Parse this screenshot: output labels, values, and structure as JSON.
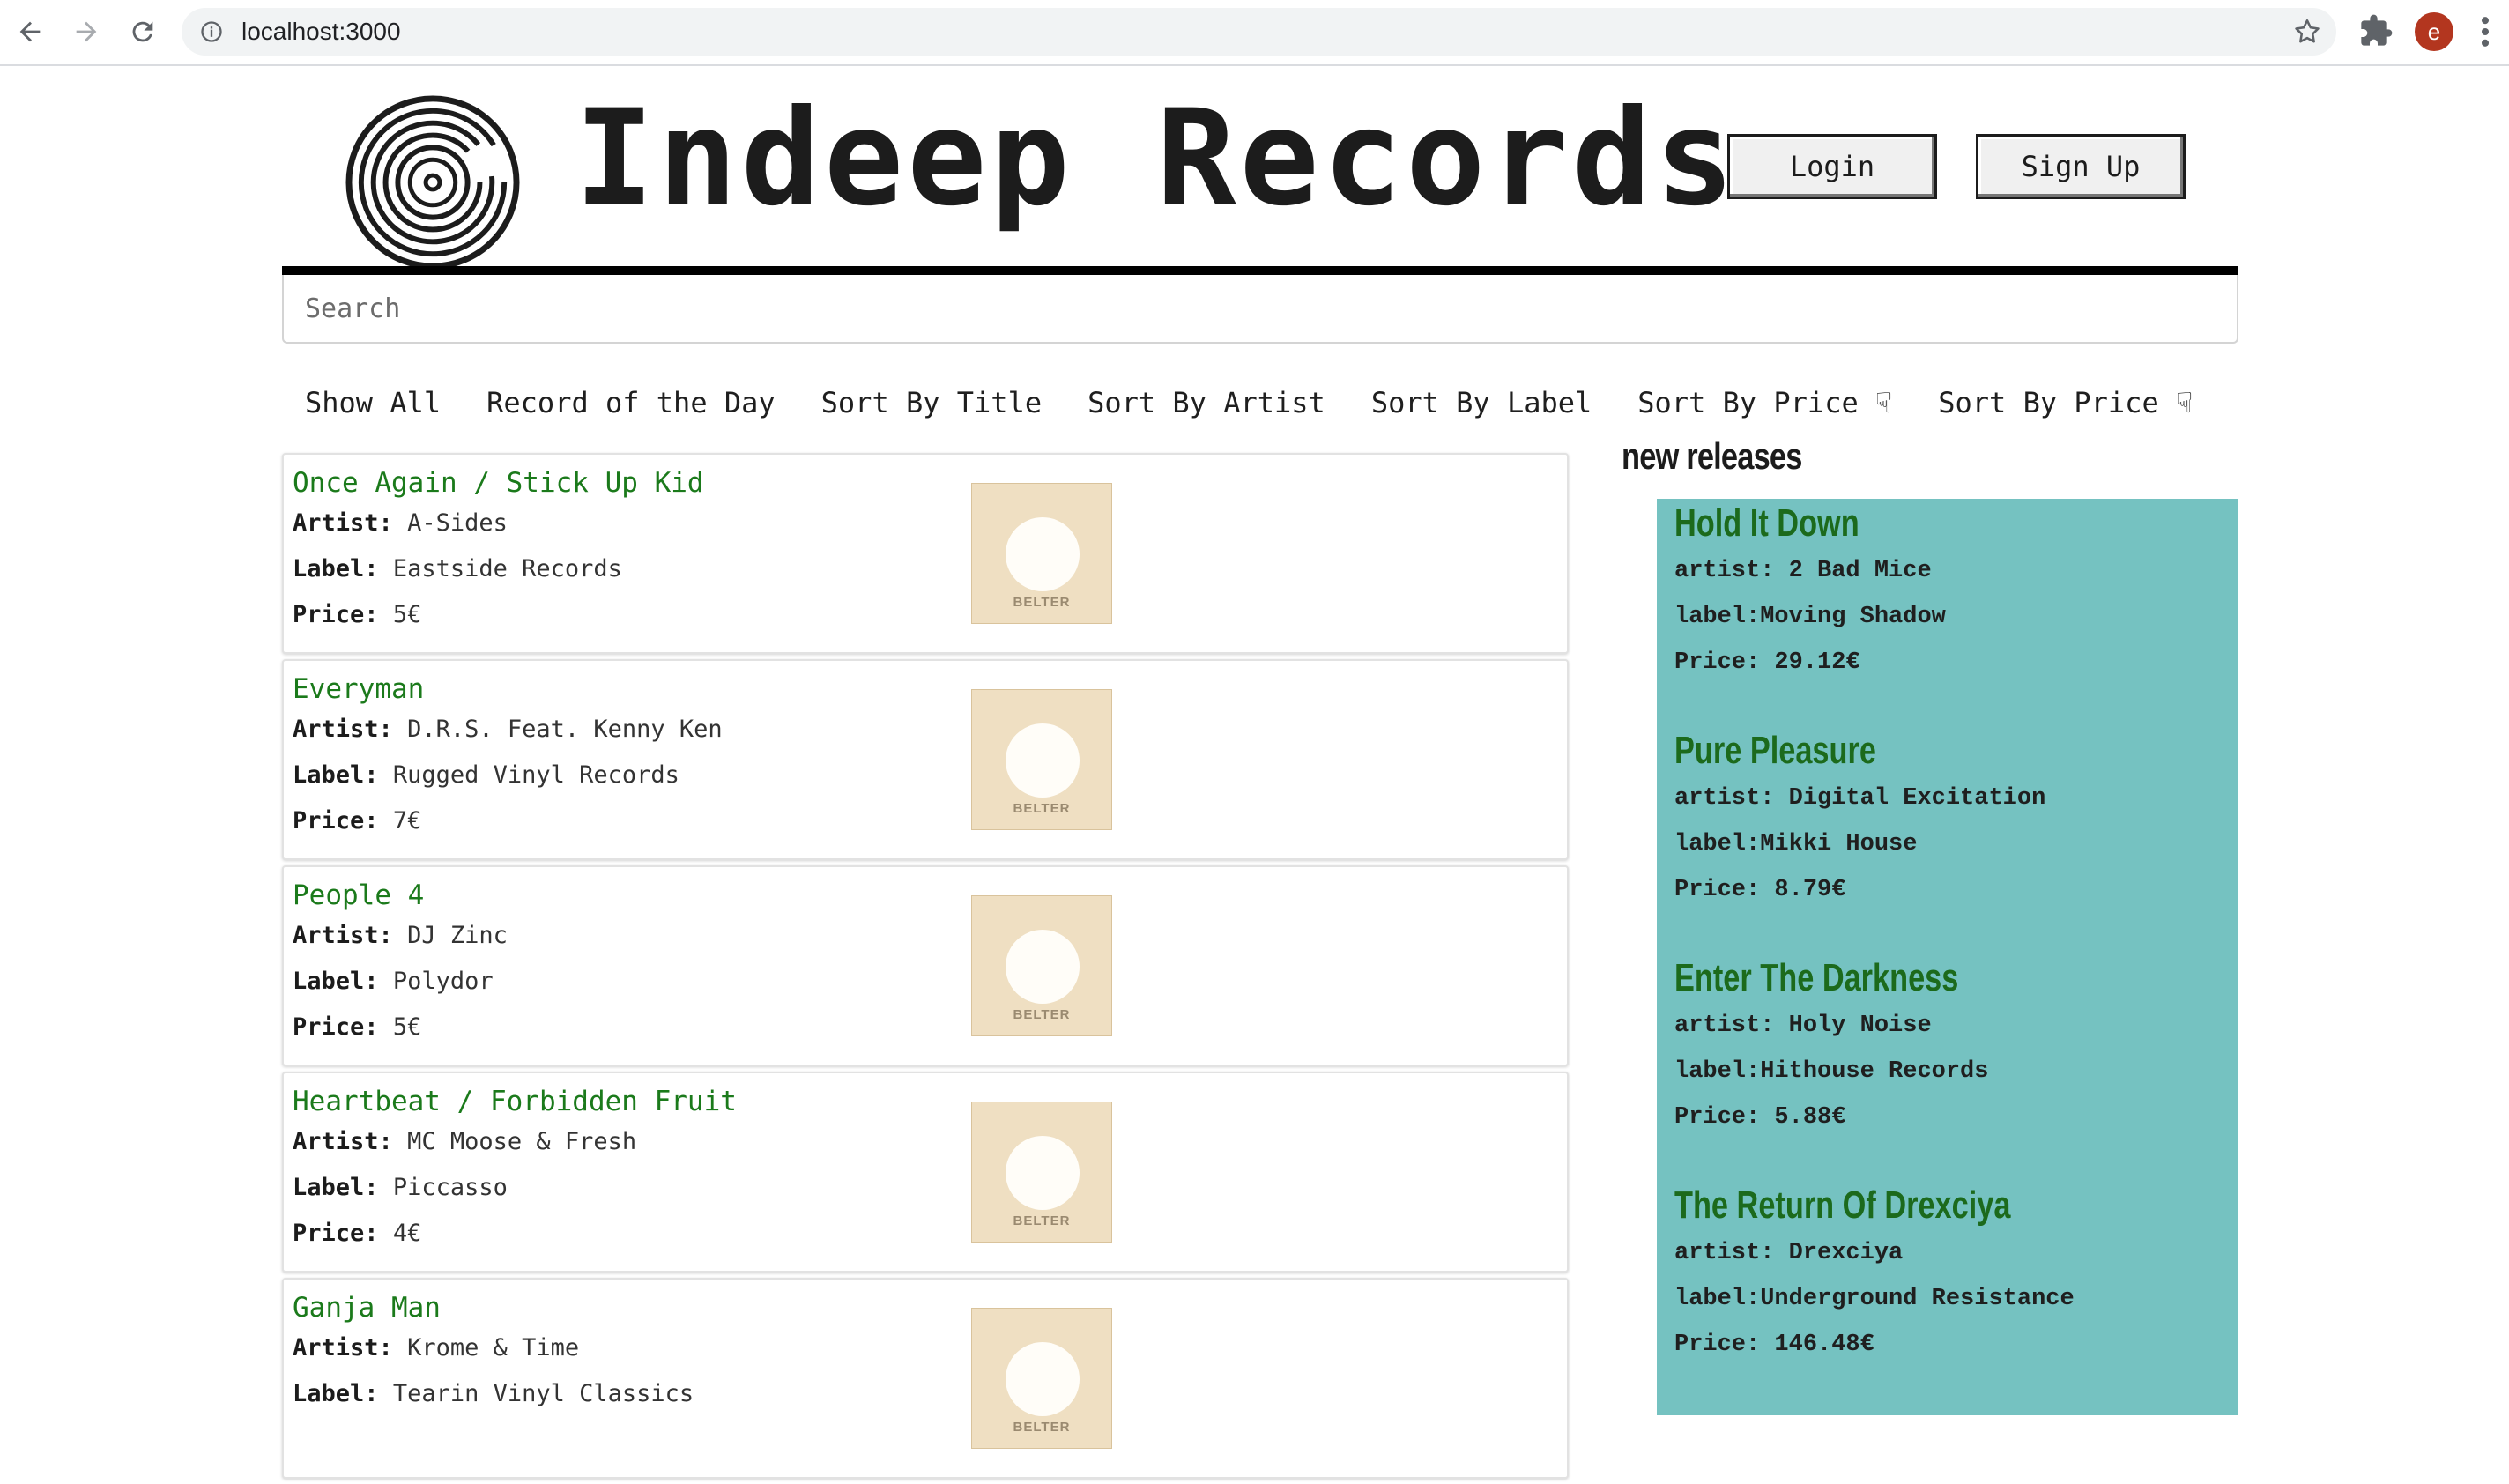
{
  "browser": {
    "url": "localhost:3000",
    "profile_initial": "e"
  },
  "header": {
    "title": "Indeep Records",
    "login_label": "Login",
    "signup_label": "Sign Up"
  },
  "search": {
    "placeholder": "Search"
  },
  "sortbar": {
    "items": [
      "Show All",
      "Record of the Day",
      "Sort By Title",
      "Sort By Artist",
      "Sort By Label",
      "Sort By Price ☟",
      "Sort By Price ☟"
    ]
  },
  "labels": {
    "artist": "Artist:",
    "label": "Label:",
    "price": "Price:"
  },
  "records": [
    {
      "title": "Once Again / Stick Up Kid",
      "artist": "A-Sides",
      "label": "Eastside Records",
      "price": "5€",
      "sleeve_brand": "BELTER"
    },
    {
      "title": "Everyman",
      "artist": "D.R.S. Feat. Kenny Ken",
      "label": "Rugged Vinyl Records",
      "price": "7€",
      "sleeve_brand": "BELTER"
    },
    {
      "title": "People 4",
      "artist": "DJ Zinc",
      "label": "Polydor",
      "price": "5€",
      "sleeve_brand": "BELTER"
    },
    {
      "title": "Heartbeat / Forbidden Fruit",
      "artist": "MC Moose & Fresh",
      "label": "Piccasso",
      "price": "4€",
      "sleeve_brand": "BELTER"
    },
    {
      "title": "Ganja Man",
      "artist": "Krome & Time",
      "label": "Tearin Vinyl Classics",
      "price": "",
      "sleeve_brand": "BELTER"
    }
  ],
  "new_releases": {
    "heading": "new releases",
    "artist_label": "artist:",
    "label_label": "label:",
    "price_label": "Price:",
    "items": [
      {
        "title": "Hold It Down",
        "artist": "2 Bad Mice",
        "label": "Moving Shadow",
        "price": "29.12€"
      },
      {
        "title": "Pure Pleasure",
        "artist": "Digital Excitation",
        "label": "Mikki House",
        "price": "8.79€"
      },
      {
        "title": "Enter The Darkness",
        "artist": "Holy Noise",
        "label": "Hithouse Records",
        "price": "5.88€"
      },
      {
        "title": "The Return Of Drexciya",
        "artist": "Drexciya",
        "label": "Underground Resistance",
        "price": "146.48€"
      }
    ]
  },
  "colors": {
    "accent_green": "#1b7a1b",
    "panel_teal": "#75c2c1",
    "profile_red": "#b3361f"
  }
}
